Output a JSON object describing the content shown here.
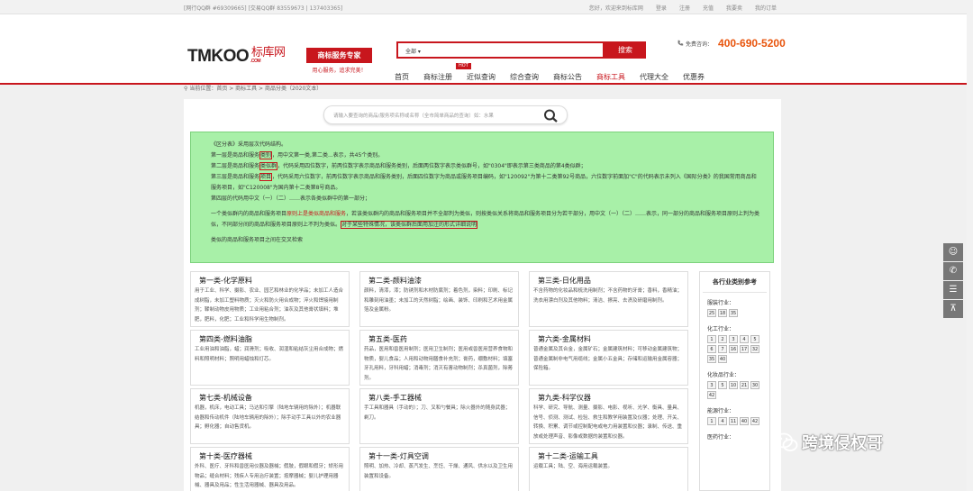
{
  "topbar": {
    "left_text": "[网行QQ群 #69309665] [交易QQ群 83559673 | 137403365]",
    "links": [
      "您好，欢迎来到标库网",
      "登录",
      "注册",
      "充值",
      "我要卖",
      "我的订单"
    ]
  },
  "logo": {
    "brand": "TMKOO",
    "cn": "标库网",
    "com": ".COM"
  },
  "slogan": {
    "badge": "商标服务专家",
    "sub": "用心服务，追求完美！"
  },
  "search": {
    "scope": "全部",
    "placeholder": "",
    "button": "搜索"
  },
  "phone": {
    "label": "免费咨询：",
    "number": "400-690-5200"
  },
  "nav": {
    "hot_label": "HOT",
    "items": [
      "首页",
      "商标注册",
      "近似查询",
      "综合查询",
      "商标公告",
      "商标工具",
      "代理大全",
      "优惠券"
    ],
    "active": "商标工具"
  },
  "breadcrumb": "当前位置：首页 > 商标工具 > 商品分类（2020文本）",
  "quick_search": {
    "placeholder": "请输入要查询的商品/服务项名称或名称（全市简单商品的查询）如：水果"
  },
  "info": {
    "l1": "《区分表》采用层次代码结构。",
    "l2a": "第一层是商品和服务",
    "l2b": "类别",
    "l2c": "，用中文第一类,第二类...表示，共45个类别。",
    "l3a": "第二层是商品和服务",
    "l3b": "类似群",
    "l3c": "，代码采用四位数字，前两位数字表示商品和服务类别，后面两位数字表示类似群号，如\"0304\"即表示第三类商品的第4类似群；",
    "l4a": "第三层是商品和服务",
    "l4b": "项目",
    "l4c": "，代码采用六位数字，前两位数字表示商品和服务类别，后面四位数字为商品或服务项目编码，如\"120092\"为第十二类第92号商品，六位数字前面加\"C\"的代码表示未列入《国际分类》的我国常用商品和服务项目，如\"C120008\"为国内第十二类第8号商品。",
    "l5": "第四层的代码用中文（一）（二）……表示各类似群中的第一部分；",
    "l6a": "一个类似群内的商品和服务项目",
    "l6b": "原则上是类似商品和服务",
    "l6c": "，若该类似群内的商品和服务项目并不全部判为类似，则按类似关系将商品和服务项目分为若干部分，用中文（一）（二）……表示，同一部分的商品和服务项目原则上判为类似，不同部分间的商品和服务项目原则上不判为类似。",
    "l6d": "对于某些特殊情况，该类似群后面用加注的形式详细说明",
    "l7": "类似的商品和服务项目之间在交叉检索"
  },
  "cards": [
    {
      "title": "第一类-化学原料",
      "desc": "用于工业、科学、摄影、农业、园艺和林业的化学品；未加工人造合成树脂，未加工塑料物质；灭火和防火用合成物；淬火和焊接用制剂；鞣制动物皮用物质；工业用粘合剂；油灰及其他膏状填料；堆肥，肥料，化肥；工业和科学用生物制剂。"
    },
    {
      "title": "第二类-颜料油漆",
      "desc": "颜料，清漆，漆；防锈剂和木材防腐剂；着色剂，染料；印刷、标记和雕刻用油墨；未加工的天然树脂；绘画、装饰、印刷和艺术用金属箔及金属粉。"
    },
    {
      "title": "第三类-日化用品",
      "desc": "不含药物的化妆品和梳洗用制剂；不含药物的牙膏；香料，香精油；洗衣用漂白剂及其他物料；清洁、擦亮、去渍及研磨用制剂。"
    },
    {
      "title": "第四类-燃料油脂",
      "desc": "工业用油和油脂，蜡；润滑剂；吸收、润湿和粘结灰尘用合成物；燃料和照明材料；照明用蜡烛和灯芯。"
    },
    {
      "title": "第五类-医药",
      "desc": "药品，医用和兽医用制剂；医用卫生制剂；医用或兽医用营养食物和物质，婴儿食品；人用和动物用膳食补充剂；膏药，绷敷材料；填塞牙孔用料，牙科用蜡；消毒剂；消灭有害动物制剂；杀真菌剂，除莠剂。"
    },
    {
      "title": "第六类-金属材料",
      "desc": "普通金属及其合金，金属矿石；金属建筑材料；可移动金属建筑物；普通金属制非电气用缆线；金属小五金具；存储和运输用金属容器；保险箱。"
    },
    {
      "title": "第七类-机械设备",
      "desc": "机器，机床，电动工具；马达和引擎（陆地车辆用的除外）；机器联结器和传动机件（陆地车辆用的除外）；除手动手工具以外的农业器具；孵化器；自动售货机。"
    },
    {
      "title": "第八类-手工器械",
      "desc": "手工具和器具（手动的）；刀、叉和勺餐具；除火器外的随身武器；剃刀。"
    },
    {
      "title": "第九类-科学仪器",
      "desc": "科学、研究、导航、测量、摄影、电影、视听、光学、衡具、量具、信号、侦测、测试、检验、救生和教学用装置及仪器；处理、开关、转换、积累、调节或控制配电或电力用装置和仪器；录制、传送、重放或处理声音、影像或数据的装置和仪器。"
    },
    {
      "title": "第十类-医疗器械",
      "desc": "外科、医疗、牙科和兽医用仪器及器械；假肢，假眼和假牙；矫形用物品；缝合材料；残疾人专用治疗装置；按摩器械；婴儿护理用器械、器具及用品；性生活用器械、器具及用品。"
    },
    {
      "title": "第十一类-灯具空调",
      "desc": "照明、加热、冷却、蒸汽发生、烹饪、干燥、通风、供水以及卫生用装置和设备。"
    },
    {
      "title": "第十二类-运输工具",
      "desc": "运载工具；陆、空、海用运载装置。"
    }
  ],
  "sidebar": {
    "title": "各行业类别参考",
    "groups": [
      {
        "label": "服装行业：",
        "nums": [
          "25",
          "18",
          "35"
        ]
      },
      {
        "label": "化工行业：",
        "nums": [
          "1",
          "2",
          "3",
          "4",
          "5",
          "6",
          "7",
          "16",
          "17",
          "32",
          "35",
          "40"
        ]
      },
      {
        "label": "化妆品行业：",
        "nums": [
          "3",
          "5",
          "10",
          "21",
          "30",
          "42"
        ]
      },
      {
        "label": "能源行业：",
        "nums": [
          "1",
          "4",
          "11",
          "40",
          "42"
        ]
      },
      {
        "label": "医药行业：",
        "nums": []
      }
    ]
  },
  "watermark": "跨境侵权哥"
}
